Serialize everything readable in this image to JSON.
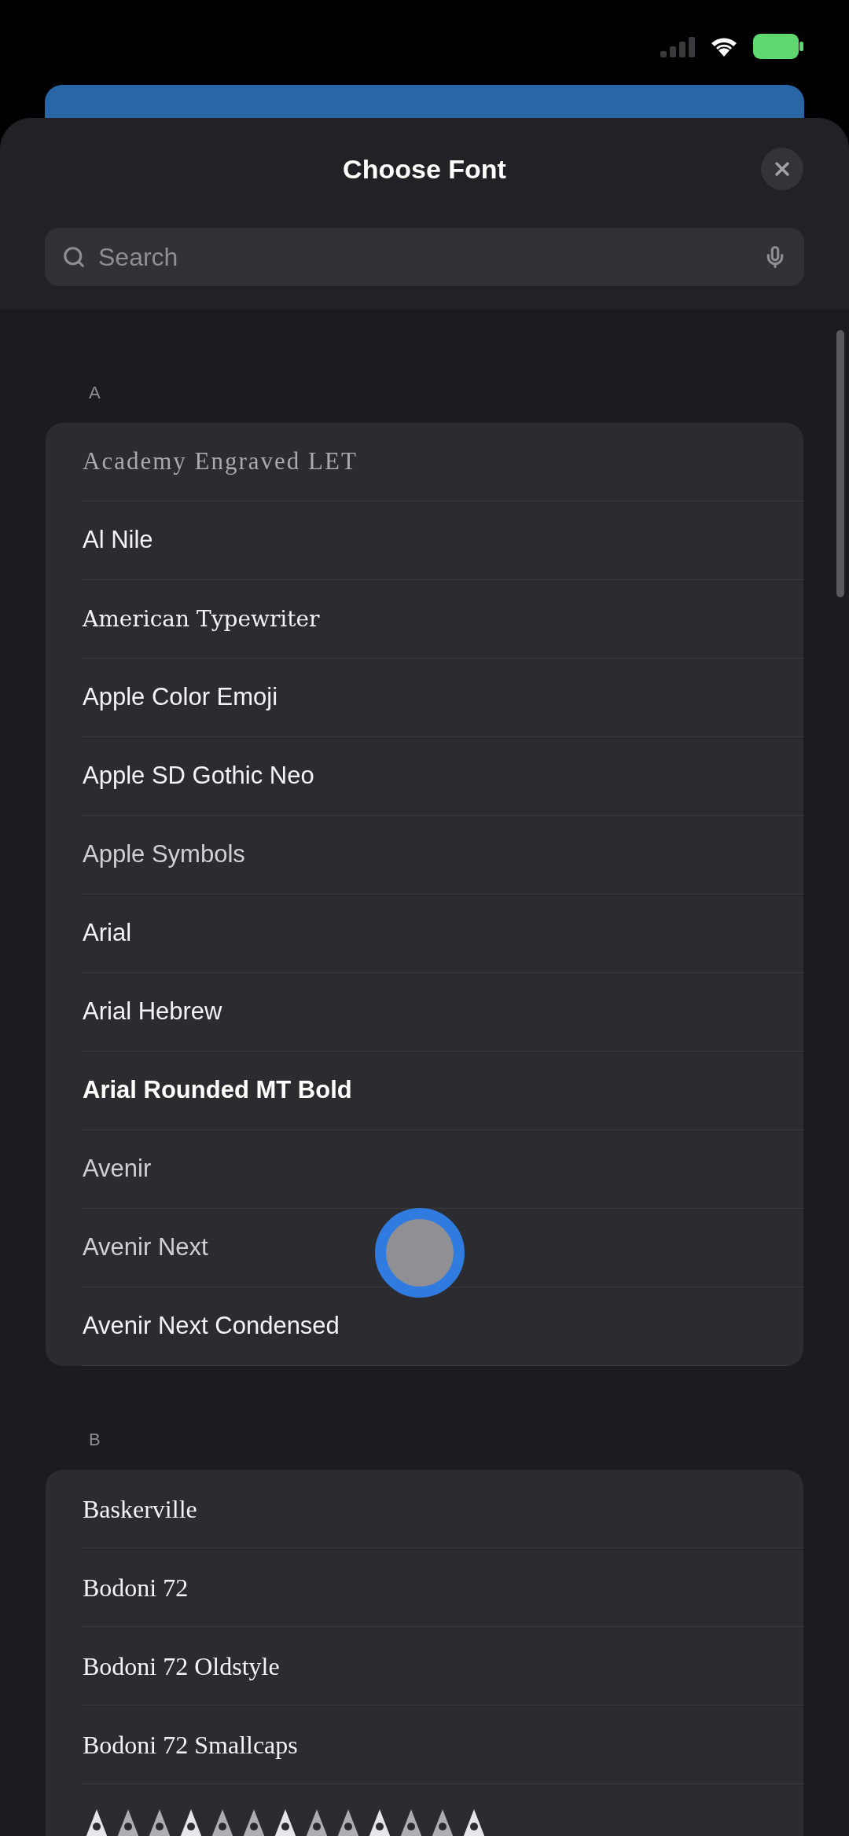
{
  "sheet": {
    "title": "Choose Font"
  },
  "search": {
    "placeholder": "Search"
  },
  "sections": [
    {
      "header": "A",
      "fonts": [
        {
          "name": "Academy Engraved LET",
          "kind": "engraved"
        },
        {
          "name": "Al Nile",
          "kind": "sans"
        },
        {
          "name": "American Typewriter",
          "kind": "typewriter"
        },
        {
          "name": "Apple Color Emoji",
          "kind": "sans"
        },
        {
          "name": "Apple SD Gothic Neo",
          "kind": "sans"
        },
        {
          "name": "Apple Symbols",
          "kind": "light"
        },
        {
          "name": "Arial",
          "kind": "sans"
        },
        {
          "name": "Arial Hebrew",
          "kind": "sans"
        },
        {
          "name": "Arial Rounded MT Bold",
          "kind": "bold"
        },
        {
          "name": "Avenir",
          "kind": "light"
        },
        {
          "name": "Avenir Next",
          "kind": "light"
        },
        {
          "name": "Avenir Next Condensed",
          "kind": "sans"
        }
      ]
    },
    {
      "header": "B",
      "fonts": [
        {
          "name": "Baskerville",
          "kind": "serif"
        },
        {
          "name": "Bodoni 72",
          "kind": "serif"
        },
        {
          "name": "Bodoni 72 Oldstyle",
          "kind": "serif"
        },
        {
          "name": "Bodoni 72 Smallcaps",
          "kind": "serif"
        },
        {
          "kind": "ornament"
        }
      ]
    }
  ]
}
